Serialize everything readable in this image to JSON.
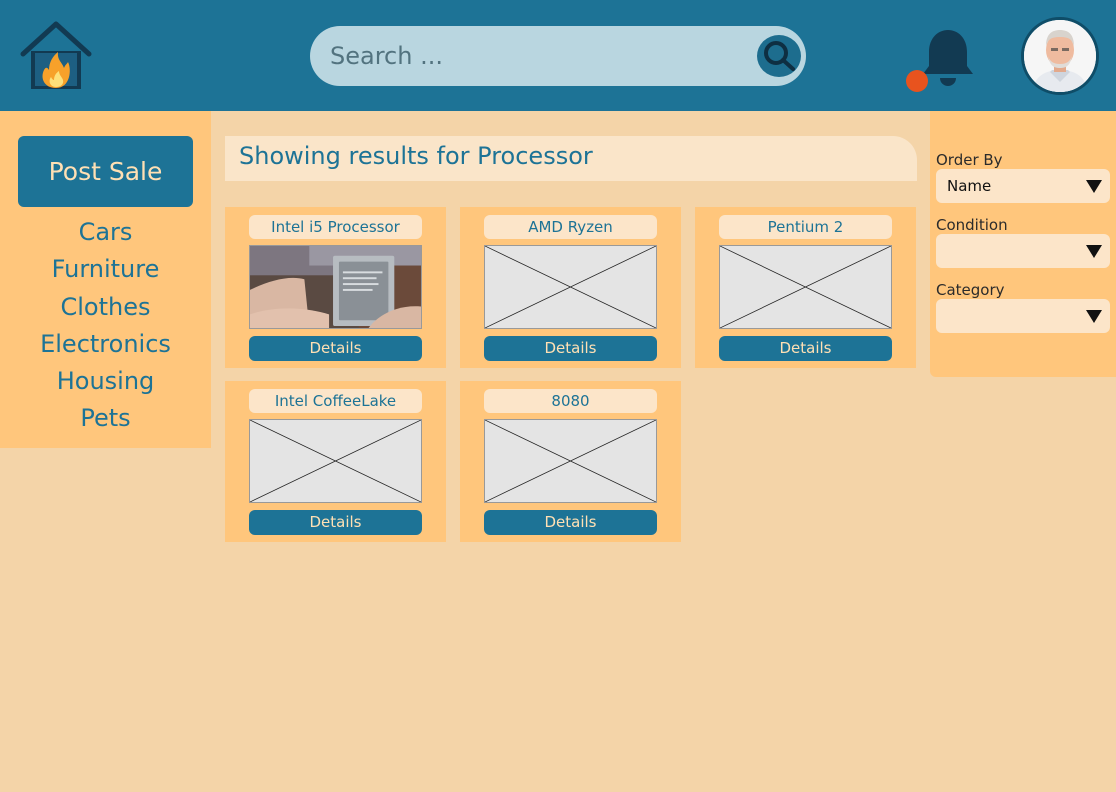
{
  "header": {
    "search_placeholder": "Search ...",
    "logo_icon": "house-fire-icon",
    "search_icon": "search-icon",
    "notification_icon": "bell-icon",
    "avatar": "user-avatar"
  },
  "sidebar": {
    "post_sale_label": "Post Sale",
    "categories": [
      "Cars",
      "Furniture",
      "Clothes",
      "Electronics",
      "Housing",
      "Pets"
    ]
  },
  "results": {
    "heading": "Showing results for Processor"
  },
  "listings": [
    {
      "title": "Intel i5 Processor",
      "image": "photo",
      "button": "Details"
    },
    {
      "title": "AMD Ryzen",
      "image": "placeholder",
      "button": "Details"
    },
    {
      "title": "Pentium 2",
      "image": "placeholder",
      "button": "Details"
    },
    {
      "title": "Intel CoffeeLake",
      "image": "placeholder",
      "button": "Details"
    },
    {
      "title": "8080",
      "image": "placeholder",
      "button": "Details"
    }
  ],
  "filters": {
    "order_by_label": "Order By",
    "order_by_value": "Name",
    "condition_label": "Condition",
    "condition_value": "",
    "category_label": "Category",
    "category_value": ""
  },
  "colors": {
    "header_bg": "#1d7396",
    "page_bg": "#f4d4a8",
    "panel_bg": "#ffc67c",
    "accent": "#1d7396",
    "notification_dot": "#e8531e"
  }
}
